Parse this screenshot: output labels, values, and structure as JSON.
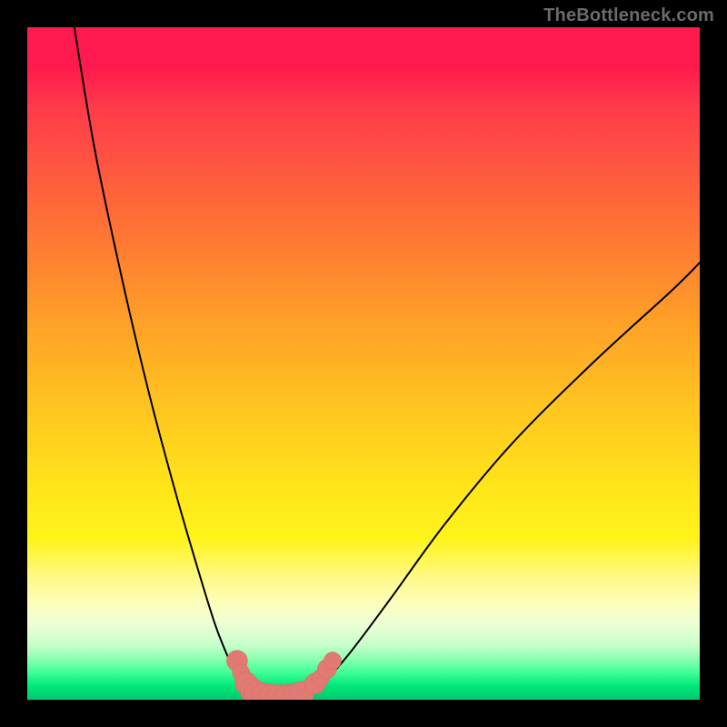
{
  "watermark": {
    "text": "TheBottleneck.com"
  },
  "colors": {
    "background": "#000000",
    "curve_stroke": "#000000",
    "marker_fill": "#e07a72",
    "marker_stroke": "#d86a62"
  },
  "chart_data": {
    "type": "line",
    "title": "",
    "xlabel": "",
    "ylabel": "",
    "xlim": [
      0,
      100
    ],
    "ylim": [
      0,
      100
    ],
    "grid": false,
    "legend": false,
    "series": [
      {
        "name": "left-branch",
        "x": [
          7,
          10,
          14,
          18,
          22,
          25.5,
          28,
          30,
          31.5,
          33,
          34
        ],
        "y": [
          100,
          82,
          63,
          46,
          31,
          19,
          11,
          6,
          3,
          1.2,
          0.6
        ]
      },
      {
        "name": "trough",
        "x": [
          34,
          36,
          38,
          40,
          41.5
        ],
        "y": [
          0.6,
          0.3,
          0.25,
          0.35,
          0.8
        ]
      },
      {
        "name": "right-branch",
        "x": [
          41.5,
          44,
          48,
          54,
          62,
          72,
          84,
          96,
          100
        ],
        "y": [
          0.8,
          2.5,
          7,
          15,
          26,
          38,
          50,
          61,
          65
        ]
      }
    ],
    "markers": [
      {
        "x": 31.2,
        "y": 5.8,
        "r": 1.2
      },
      {
        "x": 31.8,
        "y": 4.0,
        "r": 1.0
      },
      {
        "x": 32.6,
        "y": 2.4,
        "r": 1.3
      },
      {
        "x": 33.4,
        "y": 1.4,
        "r": 1.4
      },
      {
        "x": 34.2,
        "y": 0.8,
        "r": 1.5
      },
      {
        "x": 35.2,
        "y": 0.5,
        "r": 1.5
      },
      {
        "x": 36.4,
        "y": 0.35,
        "r": 1.5
      },
      {
        "x": 37.6,
        "y": 0.3,
        "r": 1.5
      },
      {
        "x": 38.8,
        "y": 0.35,
        "r": 1.5
      },
      {
        "x": 39.8,
        "y": 0.55,
        "r": 1.4
      },
      {
        "x": 40.8,
        "y": 0.9,
        "r": 1.4
      },
      {
        "x": 42.8,
        "y": 2.4,
        "r": 1.2
      },
      {
        "x": 43.6,
        "y": 3.2,
        "r": 1.0
      },
      {
        "x": 44.6,
        "y": 4.6,
        "r": 1.1
      },
      {
        "x": 45.4,
        "y": 5.8,
        "r": 1.0
      }
    ]
  }
}
